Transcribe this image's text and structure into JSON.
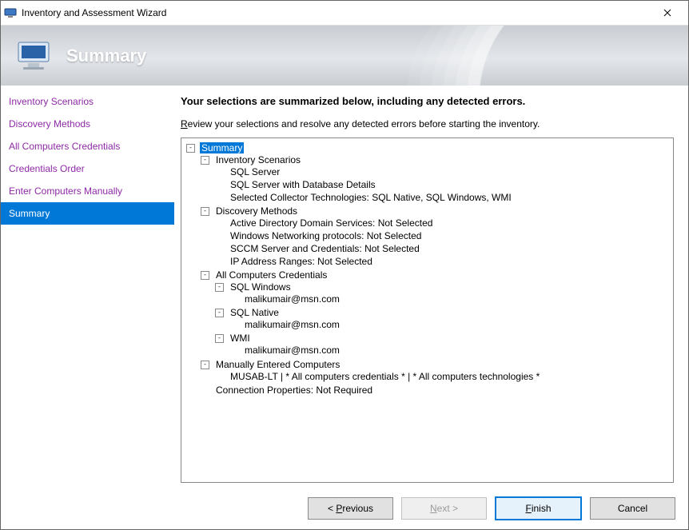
{
  "window": {
    "title": "Inventory and Assessment Wizard"
  },
  "banner": {
    "title": "Summary"
  },
  "nav": {
    "items": [
      {
        "label": "Inventory Scenarios",
        "state": "done"
      },
      {
        "label": "Discovery Methods",
        "state": "done"
      },
      {
        "label": "All Computers Credentials",
        "state": "done"
      },
      {
        "label": "Credentials Order",
        "state": "done"
      },
      {
        "label": "Enter Computers Manually",
        "state": "done"
      },
      {
        "label": "Summary",
        "state": "current"
      }
    ]
  },
  "content": {
    "heading": "Your selections are summarized below, including any detected errors.",
    "instruction_first": "R",
    "instruction_rest": "eview your selections and resolve any detected errors before starting the inventory."
  },
  "tree": {
    "label": "Summary",
    "selected": true,
    "children": [
      {
        "label": "Inventory Scenarios",
        "children": [
          {
            "label": "SQL Server"
          },
          {
            "label": "SQL Server with Database Details"
          },
          {
            "label": "Selected Collector Technologies: SQL Native, SQL Windows, WMI"
          }
        ]
      },
      {
        "label": "Discovery Methods",
        "children": [
          {
            "label": "Active Directory Domain Services: Not Selected"
          },
          {
            "label": "Windows Networking protocols: Not Selected"
          },
          {
            "label": "SCCM Server and Credentials: Not Selected"
          },
          {
            "label": "IP Address Ranges: Not Selected"
          }
        ]
      },
      {
        "label": "All Computers Credentials",
        "children": [
          {
            "label": "SQL Windows",
            "children": [
              {
                "label": "malikumair@msn.com"
              }
            ]
          },
          {
            "label": "SQL Native",
            "children": [
              {
                "label": "malikumair@msn.com"
              }
            ]
          },
          {
            "label": "WMI",
            "children": [
              {
                "label": "malikumair@msn.com"
              }
            ]
          }
        ]
      },
      {
        "label": "Manually Entered Computers",
        "children": [
          {
            "label": "MUSAB-LT | * All computers credentials * | * All computers technologies *"
          }
        ]
      },
      {
        "label": "Connection Properties: Not Required"
      }
    ]
  },
  "buttons": {
    "previous": {
      "accel": "P",
      "rest": "revious"
    },
    "next": {
      "accel": "N",
      "rest": "ext"
    },
    "finish": {
      "accel": "F",
      "rest": "inish"
    },
    "cancel": {
      "label": "Cancel"
    }
  }
}
